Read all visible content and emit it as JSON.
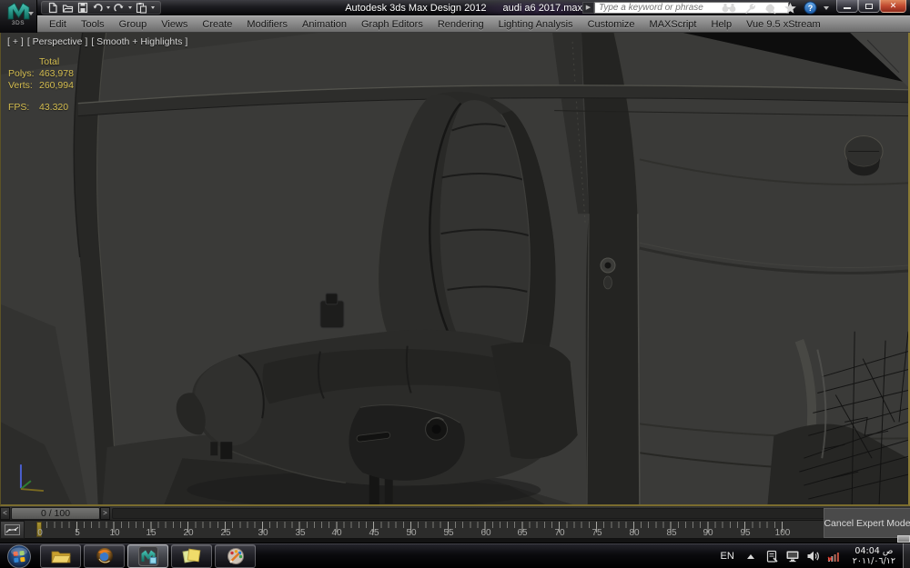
{
  "titlebar": {
    "logo_text": "3DS",
    "product_title": "Autodesk 3ds Max Design 2012",
    "file_title": "audi a6 2017.max",
    "search_placeholder": "Type a keyword or phrase",
    "qat_icons": [
      "new-scene-icon",
      "open-file-icon",
      "save-file-icon",
      "undo-icon",
      "redo-icon",
      "paste-icon"
    ],
    "search_icons": [
      "search-binoculars-icon",
      "communication-center-icon",
      "subscription-center-icon",
      "favorites-icon",
      "help-icon"
    ]
  },
  "menubar": {
    "items": [
      "Edit",
      "Tools",
      "Group",
      "Views",
      "Create",
      "Modifiers",
      "Animation",
      "Graph Editors",
      "Rendering",
      "Lighting Analysis",
      "Customize",
      "MAXScript",
      "Help",
      "Vue 9.5 xStream"
    ]
  },
  "viewport": {
    "label_plus": "[ + ]",
    "label_pov": "[ Perspective ]",
    "label_shading": "[ Smooth + Highlights ]",
    "stats": {
      "header": "Total",
      "polys_label": "Polys:",
      "polys_value": "463,978",
      "verts_label": "Verts:",
      "verts_value": "260,994",
      "fps_label": "FPS:",
      "fps_value": "43.320"
    }
  },
  "timeline": {
    "prev": "<",
    "next": ">",
    "slider_label": "0 / 100",
    "tick_labels": [
      "0",
      "5",
      "10",
      "15",
      "20",
      "25",
      "30",
      "35",
      "40",
      "45",
      "50",
      "55",
      "60",
      "65",
      "70",
      "75",
      "80",
      "85",
      "90",
      "95",
      "100"
    ]
  },
  "expert": {
    "cancel_label": "Cancel Expert Mode"
  },
  "taskbar": {
    "app_icons": [
      "windows-explorer",
      "firefox",
      "3ds-max",
      "sticky-notes",
      "paint"
    ],
    "active_app": "3ds-max",
    "tray_language": "EN",
    "tray_icons": [
      "action-center-icon",
      "display-icon",
      "volume-icon",
      "network-status-icon"
    ],
    "clock_time": "ص 04:04",
    "clock_date": "٢٠١١/٠٦/١٢"
  },
  "colors": {
    "stats_yellow": "#d4bd50",
    "viewport_bg": "#3a3a38",
    "frame_marker_olive": "#8a7a28",
    "close_button_red": "#c14a30",
    "menubar_gray": "#8a8a8a"
  }
}
